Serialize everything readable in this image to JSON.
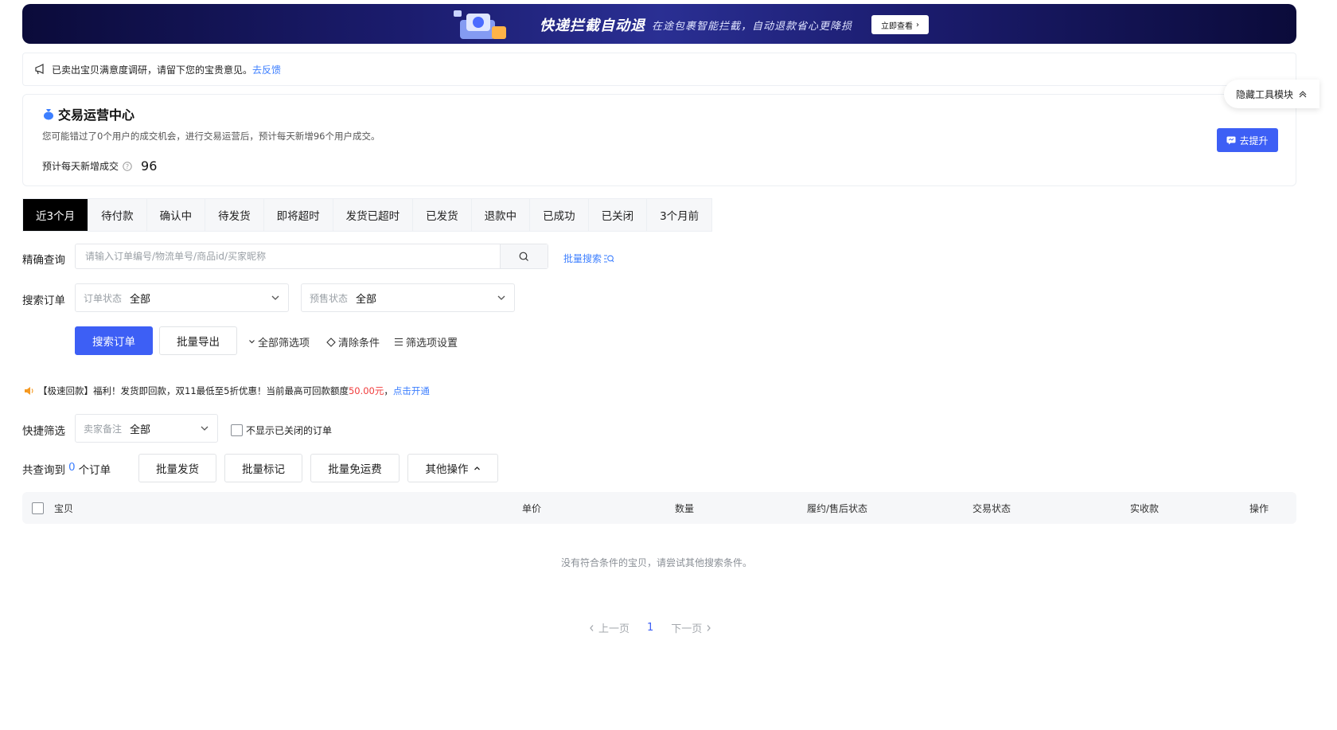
{
  "banner": {
    "title": "快递拦截自动退",
    "subtitle": "在途包裹智能拦截，自动退款省心更降损",
    "button": "立即查看"
  },
  "notice": {
    "text": "已卖出宝贝满意度调研，请留下您的宝贵意见。",
    "link": "去反馈"
  },
  "ops_center": {
    "title": "交易运营中心",
    "description": "您可能错过了0个用户的成交机会，进行交易运营后，预计每天新增96个用户成交。",
    "predict_label": "预计每天新增成交",
    "predict_value": "96",
    "upgrade_button": "去提升"
  },
  "hide_tools": "隐藏工具模块",
  "tabs": [
    "近3个月",
    "待付款",
    "确认中",
    "待发货",
    "即将超时",
    "发货已超时",
    "已发货",
    "退款中",
    "已成功",
    "已关闭",
    "3个月前"
  ],
  "precise_search": {
    "label": "精确查询",
    "placeholder": "请输入订单编号/物流单号/商品id/买家昵称",
    "batch_search": "批量搜索"
  },
  "search_orders": {
    "label": "搜索订单",
    "order_status_prefix": "订单状态",
    "order_status_value": "全部",
    "presale_prefix": "预售状态",
    "presale_value": "全部"
  },
  "actions": {
    "search_button": "搜索订单",
    "export_button": "批量导出",
    "all_filters": "全部筛选项",
    "clear_conditions": "清除条件",
    "filter_settings": "筛选项设置"
  },
  "promo": {
    "text_before": "【极速回款】福利！发货即回款，双11最低至5折优惠！当前最高可回款额度",
    "amount": "50.00元",
    "separator": "，",
    "link": "点击开通"
  },
  "quick_filter": {
    "label": "快捷筛选",
    "seller_note_prefix": "卖家备注",
    "seller_note_value": "全部",
    "hide_closed": "不显示已关闭的订单"
  },
  "result_bar": {
    "prefix": "共查询到",
    "count": "0",
    "suffix": "个订单",
    "batch_ship": "批量发货",
    "batch_mark": "批量标记",
    "batch_free_shipping": "批量免运费",
    "other_ops": "其他操作"
  },
  "table": {
    "columns": [
      "宝贝",
      "单价",
      "数量",
      "履约/售后状态",
      "交易状态",
      "实收款",
      "操作"
    ],
    "empty_text": "没有符合条件的宝贝，请尝试其他搜索条件。"
  },
  "pager": {
    "prev": "上一页",
    "current": "1",
    "next": "下一页"
  },
  "colors": {
    "primary": "#3d5ff5",
    "link": "#3d7fff",
    "active_tab": "#000000",
    "highlight_red": "#f03b3b"
  }
}
